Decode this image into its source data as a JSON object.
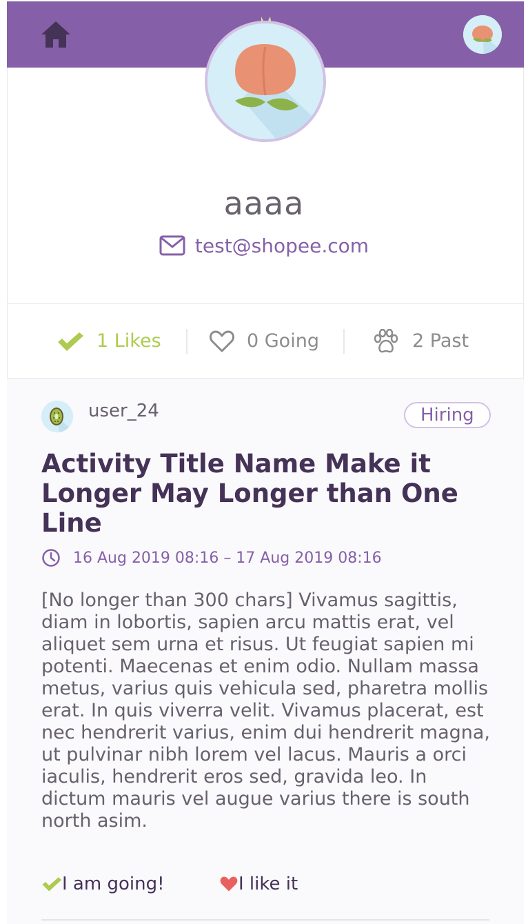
{
  "navbar": {
    "home_icon": "home-icon",
    "logo_icon": "cat-logo-icon",
    "avatar_icon": "peach-avatar-icon",
    "background_color": "#8560A8"
  },
  "profile": {
    "avatar_icon": "peach-avatar-icon",
    "name": "aaaa",
    "email": "test@shopee.com",
    "email_icon": "mail-icon"
  },
  "stats": [
    {
      "icon": "check-icon",
      "label": "1 Likes",
      "active": true
    },
    {
      "icon": "heart-outline-icon",
      "label": "0 Going",
      "active": false
    },
    {
      "icon": "paw-icon",
      "label": "2 Past",
      "active": false
    }
  ],
  "activity": {
    "user": "user_24",
    "user_avatar_icon": "kiwi-avatar-icon",
    "tag": "Hiring",
    "title": "Activity Title Name Make it Longer May Longer than One Line",
    "time_icon": "clock-icon",
    "time": "16 Aug 2019 08:16 – 17 Aug 2019 08:16",
    "description": "[No longer than 300 chars] Vivamus sagittis, diam in lobortis, sapien arcu mattis erat, vel aliquet sem urna et risus. Ut feugiat sapien mi potenti. Maecenas et enim odio. Nullam massa metus, varius quis vehicula sed, pharetra mollis erat. In quis viverra velit. Vivamus placerat, est nec hendrerit varius, enim dui hendrerit magna, ut pulvinar nibh lorem vel lacus. Mauris a orci iaculis, hendrerit eros sed, gravida leo. In dictum mauris vel augue varius there is south north asim.",
    "going_label": "I am going!",
    "like_label": "I like it"
  },
  "colors": {
    "primary": "#8560A8",
    "accent_green": "#AECB4F",
    "heart_red": "#E8615E",
    "title_dark": "#453257",
    "text_gray": "#67616D"
  }
}
